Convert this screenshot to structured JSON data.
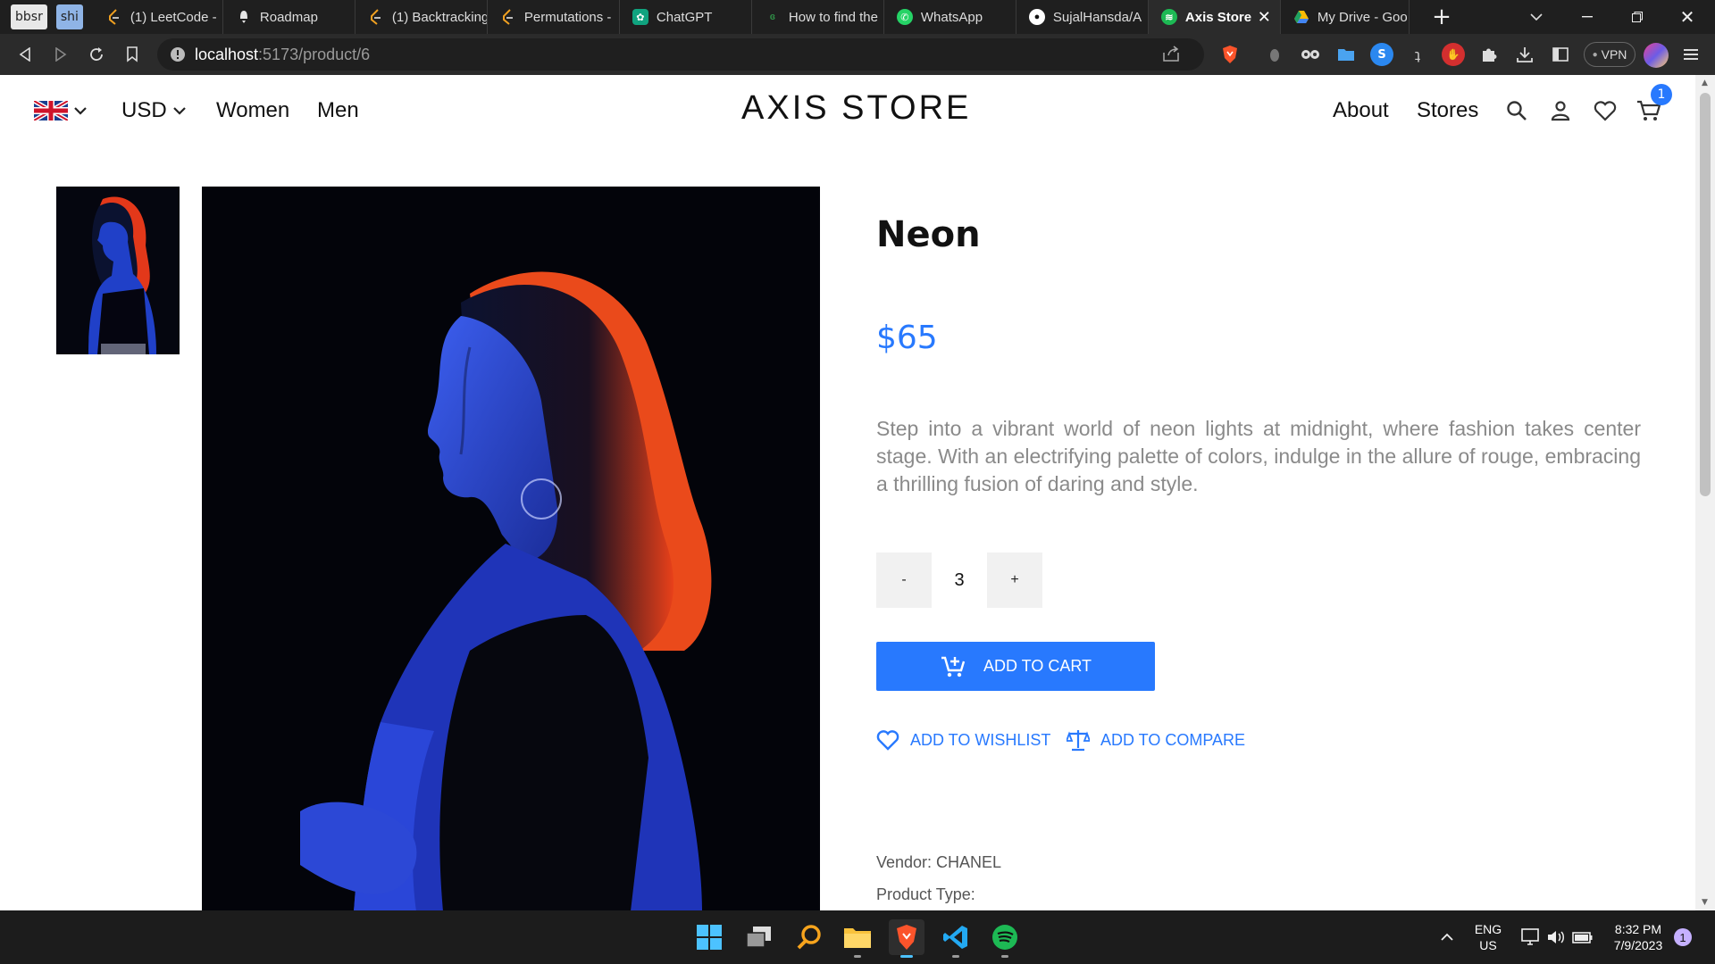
{
  "browser": {
    "bookmarks": [
      "bbsr",
      "shi"
    ],
    "tabs": [
      {
        "label": "(1) LeetCode - ",
        "icon": "leetcode-icon",
        "color": "#f0a020"
      },
      {
        "label": "Roadmap",
        "icon": "notion-icon",
        "color": "#e6e6e6"
      },
      {
        "label": "(1) Backtracking",
        "icon": "leetcode-icon",
        "color": "#f0a020"
      },
      {
        "label": "Permutations - ",
        "icon": "leetcode-icon",
        "color": "#f0a020"
      },
      {
        "label": "ChatGPT",
        "icon": "chatgpt-icon",
        "color": "#10a37f"
      },
      {
        "label": "How to find the",
        "icon": "gfg-icon",
        "color": "#2f8d46"
      },
      {
        "label": "WhatsApp",
        "icon": "whatsapp-icon",
        "color": "#25d366"
      },
      {
        "label": "SujalHansda/A",
        "icon": "github-icon",
        "color": "#ffffff"
      },
      {
        "label": "Axis Store",
        "icon": "spotify-icon",
        "color": "#1db954"
      },
      {
        "label": "My Drive - Goo",
        "icon": "google-drive-icon",
        "color": "#fbbc04"
      }
    ],
    "url_host": "localhost",
    "url_path": ":5173/product/6",
    "vpn_label": "VPN"
  },
  "header": {
    "currency": "USD",
    "nav": [
      "Women",
      "Men"
    ],
    "logo": "AXIS STORE",
    "right_nav": [
      "About",
      "Stores"
    ],
    "cart_count": "1"
  },
  "product": {
    "title": "Neon",
    "price": "$65",
    "description": "Step into a vibrant world of neon lights at midnight, where fashion takes center stage. With an electrifying palette of colors, indulge in the allure of rouge, embracing a thrilling fusion of daring and style.",
    "quantity": "3",
    "minus_label": "-",
    "plus_label": "+",
    "add_to_cart": "ADD TO CART",
    "wishlist": "ADD TO WISHLIST",
    "compare": "ADD TO COMPARE",
    "vendor": "Vendor: CHANEL",
    "product_type": "Product Type:"
  },
  "taskbar": {
    "lang_top": "ENG",
    "lang_bottom": "US",
    "time": "8:32 PM",
    "date": "7/9/2023",
    "notifications": "1"
  },
  "colors": {
    "accent": "#2879fe",
    "tab_active": "#2b2b2b",
    "taskbar": "#1c1c1c"
  }
}
